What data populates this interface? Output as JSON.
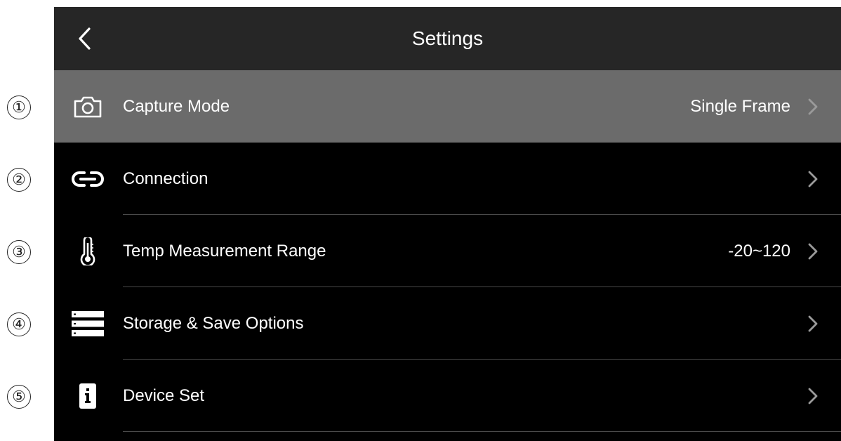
{
  "header": {
    "title": "Settings"
  },
  "callouts": [
    "①",
    "②",
    "③",
    "④",
    "⑤"
  ],
  "items": [
    {
      "label": "Capture Mode",
      "value": "Single Frame",
      "icon": "camera-icon",
      "selected": true
    },
    {
      "label": "Connection",
      "value": "",
      "icon": "link-icon",
      "selected": false
    },
    {
      "label": "Temp Measurement Range",
      "value": "-20~120",
      "icon": "thermometer-icon",
      "selected": false
    },
    {
      "label": "Storage & Save Options",
      "value": "",
      "icon": "storage-icon",
      "selected": false
    },
    {
      "label": "Device Set",
      "value": "",
      "icon": "device-info-icon",
      "selected": false
    }
  ],
  "colors": {
    "header_bg": "#262626",
    "selected_row_bg": "#6b6b6b",
    "list_bg": "#000000",
    "chevron": "#9a9a9a"
  }
}
